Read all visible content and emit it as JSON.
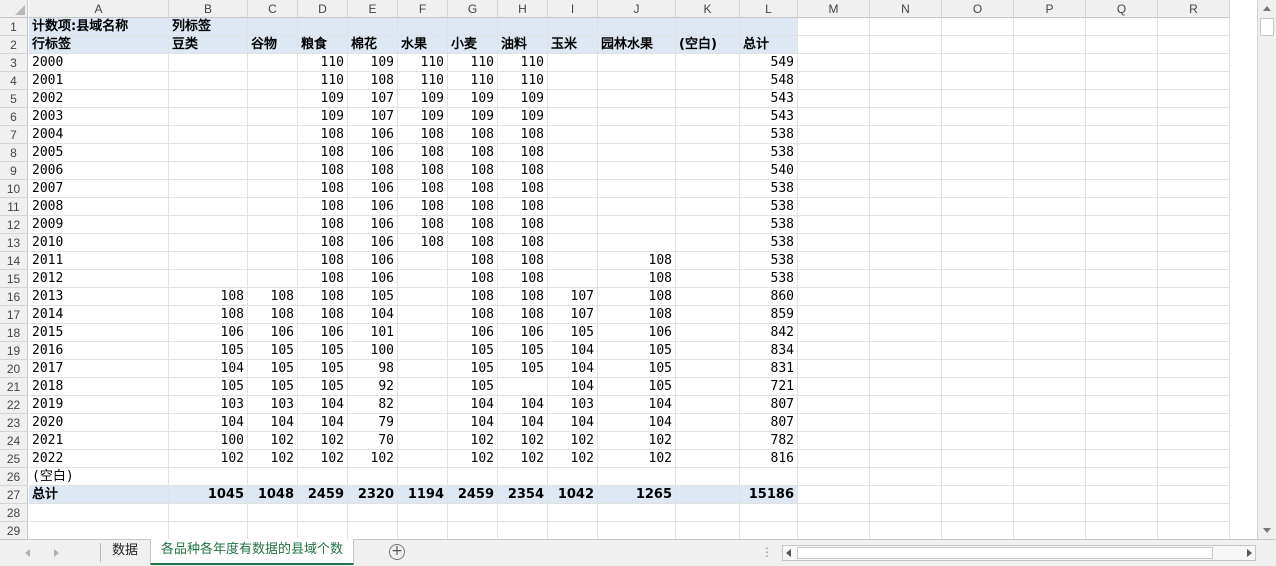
{
  "columns": [
    "A",
    "B",
    "C",
    "D",
    "E",
    "F",
    "G",
    "H",
    "I",
    "J",
    "K",
    "L",
    "M",
    "N",
    "O",
    "P",
    "Q",
    "R"
  ],
  "rows": [
    "1",
    "2",
    "3",
    "4",
    "5",
    "6",
    "7",
    "8",
    "9",
    "10",
    "11",
    "12",
    "13",
    "14",
    "15",
    "16",
    "17",
    "18",
    "19",
    "20",
    "21",
    "22",
    "23",
    "24",
    "25",
    "26",
    "27",
    "28",
    "29"
  ],
  "pivot": {
    "filter_label": "计数项:县域名称",
    "column_labels_header": "列标签",
    "row_labels_header": "行标签",
    "categories": [
      "豆类",
      "谷物",
      "粮食",
      "棉花",
      "水果",
      "小麦",
      "油料",
      "玉米",
      "园林水果",
      "(空白)",
      "总计"
    ],
    "rows": [
      {
        "label": "2000",
        "values": [
          "",
          "",
          "110",
          "109",
          "110",
          "110",
          "110",
          "",
          "",
          "",
          "549"
        ]
      },
      {
        "label": "2001",
        "values": [
          "",
          "",
          "110",
          "108",
          "110",
          "110",
          "110",
          "",
          "",
          "",
          "548"
        ]
      },
      {
        "label": "2002",
        "values": [
          "",
          "",
          "109",
          "107",
          "109",
          "109",
          "109",
          "",
          "",
          "",
          "543"
        ]
      },
      {
        "label": "2003",
        "values": [
          "",
          "",
          "109",
          "107",
          "109",
          "109",
          "109",
          "",
          "",
          "",
          "543"
        ]
      },
      {
        "label": "2004",
        "values": [
          "",
          "",
          "108",
          "106",
          "108",
          "108",
          "108",
          "",
          "",
          "",
          "538"
        ]
      },
      {
        "label": "2005",
        "values": [
          "",
          "",
          "108",
          "106",
          "108",
          "108",
          "108",
          "",
          "",
          "",
          "538"
        ]
      },
      {
        "label": "2006",
        "values": [
          "",
          "",
          "108",
          "108",
          "108",
          "108",
          "108",
          "",
          "",
          "",
          "540"
        ]
      },
      {
        "label": "2007",
        "values": [
          "",
          "",
          "108",
          "106",
          "108",
          "108",
          "108",
          "",
          "",
          "",
          "538"
        ]
      },
      {
        "label": "2008",
        "values": [
          "",
          "",
          "108",
          "106",
          "108",
          "108",
          "108",
          "",
          "",
          "",
          "538"
        ]
      },
      {
        "label": "2009",
        "values": [
          "",
          "",
          "108",
          "106",
          "108",
          "108",
          "108",
          "",
          "",
          "",
          "538"
        ]
      },
      {
        "label": "2010",
        "values": [
          "",
          "",
          "108",
          "106",
          "108",
          "108",
          "108",
          "",
          "",
          "",
          "538"
        ]
      },
      {
        "label": "2011",
        "values": [
          "",
          "",
          "108",
          "106",
          "",
          "108",
          "108",
          "",
          "108",
          "",
          "538"
        ]
      },
      {
        "label": "2012",
        "values": [
          "",
          "",
          "108",
          "106",
          "",
          "108",
          "108",
          "",
          "108",
          "",
          "538"
        ]
      },
      {
        "label": "2013",
        "values": [
          "108",
          "108",
          "108",
          "105",
          "",
          "108",
          "108",
          "107",
          "108",
          "",
          "860"
        ]
      },
      {
        "label": "2014",
        "values": [
          "108",
          "108",
          "108",
          "104",
          "",
          "108",
          "108",
          "107",
          "108",
          "",
          "859"
        ]
      },
      {
        "label": "2015",
        "values": [
          "106",
          "106",
          "106",
          "101",
          "",
          "106",
          "106",
          "105",
          "106",
          "",
          "842"
        ]
      },
      {
        "label": "2016",
        "values": [
          "105",
          "105",
          "105",
          "100",
          "",
          "105",
          "105",
          "104",
          "105",
          "",
          "834"
        ]
      },
      {
        "label": "2017",
        "values": [
          "104",
          "105",
          "105",
          "98",
          "",
          "105",
          "105",
          "104",
          "105",
          "",
          "831"
        ]
      },
      {
        "label": "2018",
        "values": [
          "105",
          "105",
          "105",
          "92",
          "",
          "105",
          "",
          "104",
          "105",
          "",
          "721"
        ]
      },
      {
        "label": "2019",
        "values": [
          "103",
          "103",
          "104",
          "82",
          "",
          "104",
          "104",
          "103",
          "104",
          "",
          "807"
        ]
      },
      {
        "label": "2020",
        "values": [
          "104",
          "104",
          "104",
          "79",
          "",
          "104",
          "104",
          "104",
          "104",
          "",
          "807"
        ]
      },
      {
        "label": "2021",
        "values": [
          "100",
          "102",
          "102",
          "70",
          "",
          "102",
          "102",
          "102",
          "102",
          "",
          "782"
        ]
      },
      {
        "label": "2022",
        "values": [
          "102",
          "102",
          "102",
          "102",
          "",
          "102",
          "102",
          "102",
          "102",
          "",
          "816"
        ]
      },
      {
        "label": "(空白)",
        "values": [
          "",
          "",
          "",
          "",
          "",
          "",
          "",
          "",
          "",
          "",
          ""
        ]
      }
    ],
    "total_row": {
      "label": "总计",
      "values": [
        "1045",
        "1048",
        "2459",
        "2320",
        "1194",
        "2459",
        "2354",
        "1042",
        "1265",
        "",
        "15186"
      ]
    }
  },
  "tabs": {
    "sheets": [
      "数据",
      "各品种各年度有数据的县域个数"
    ],
    "active": "各品种各年度有数据的县域个数",
    "add_symbol": "+",
    "more_symbol": "⋮"
  },
  "colors": {
    "header_fill": "#dde8f4",
    "active_tab": "#217346"
  }
}
